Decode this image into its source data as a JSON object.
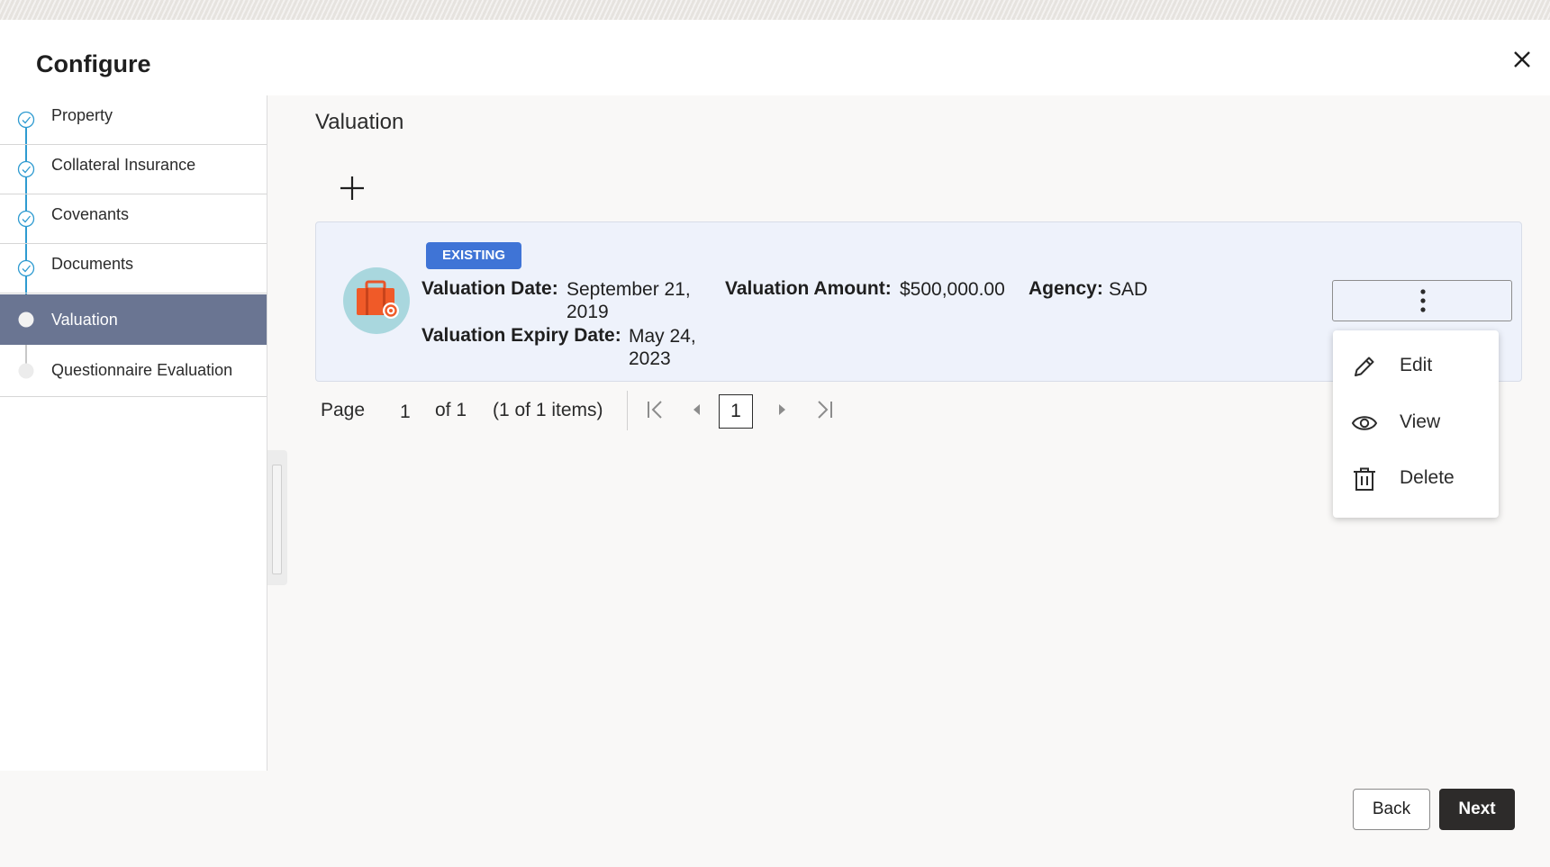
{
  "window": {
    "title": "Configure",
    "close_icon": "close-icon"
  },
  "steps": [
    {
      "label": "Property",
      "state": "completed"
    },
    {
      "label": "Collateral Insurance",
      "state": "completed"
    },
    {
      "label": "Covenants",
      "state": "completed"
    },
    {
      "label": "Documents",
      "state": "completed"
    },
    {
      "label": "Valuation",
      "state": "active"
    },
    {
      "label": "Questionnaire Evaluation",
      "state": "pending"
    }
  ],
  "main": {
    "section_title": "Valuation",
    "add_icon": "plus-icon",
    "card": {
      "badge": "EXISTING",
      "icon": "briefcase-gear-icon",
      "valuation_date_label": "Valuation Date:",
      "valuation_date_line1": "September 21,",
      "valuation_date_line2": "2019",
      "valuation_expiry_label": "Valuation Expiry Date:",
      "valuation_expiry_line1": "May 24,",
      "valuation_expiry_line2": "2023",
      "valuation_amount_label": "Valuation Amount:",
      "valuation_amount_value": "$500,000.00",
      "agency_label": "Agency:",
      "agency_value": "SAD"
    },
    "menu": {
      "items": [
        {
          "label": "Edit",
          "icon": "pencil-icon"
        },
        {
          "label": "View",
          "icon": "eye-icon"
        },
        {
          "label": "Delete",
          "icon": "trash-icon"
        }
      ]
    },
    "pagination": {
      "page_label": "Page",
      "current_page": "1",
      "of_text": "of 1",
      "items_text": "(1 of 1 items)",
      "page_box": "1"
    }
  },
  "footer": {
    "back_label": "Back",
    "next_label": "Next"
  },
  "colors": {
    "active_step": "#6a7592",
    "connector": "#2f9bd1",
    "badge": "#3f74d6",
    "card_background": "#eef2fb",
    "primary_button": "#2d2b2a"
  }
}
